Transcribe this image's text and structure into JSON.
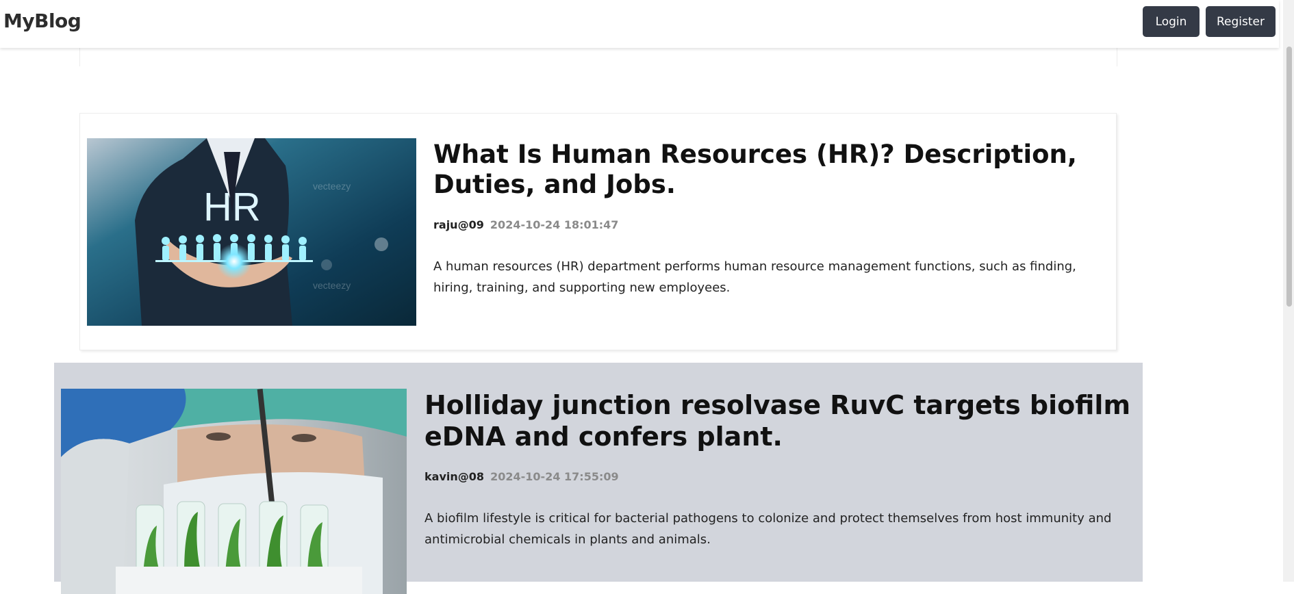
{
  "navbar": {
    "brand": "MyBlog",
    "login_label": "Login",
    "register_label": "Register"
  },
  "posts": [
    {
      "title": "What Is Human Resources (HR)? Description, Duties, and Jobs.",
      "author": "raju@09",
      "date": "2024-10-24 18:01:47",
      "excerpt": "A human resources (HR) department performs human resource management functions, such as finding, hiring, training, and supporting new employees.",
      "image_text": "HR",
      "image_watermark": "vecteezy"
    },
    {
      "title": "Holliday junction resolvase RuvC targets biofilm eDNA and confers plant.",
      "author": "kavin@08",
      "date": "2024-10-24 17:55:09",
      "excerpt": "A biofilm lifestyle is critical for bacterial pathogens to colonize and protect themselves from host immunity and antimicrobial chemicals in plants and animals."
    }
  ],
  "colors": {
    "nav_button_bg": "#343a46",
    "hover_card_bg": "#d2d5dc",
    "date_text": "#8a8a8a"
  }
}
